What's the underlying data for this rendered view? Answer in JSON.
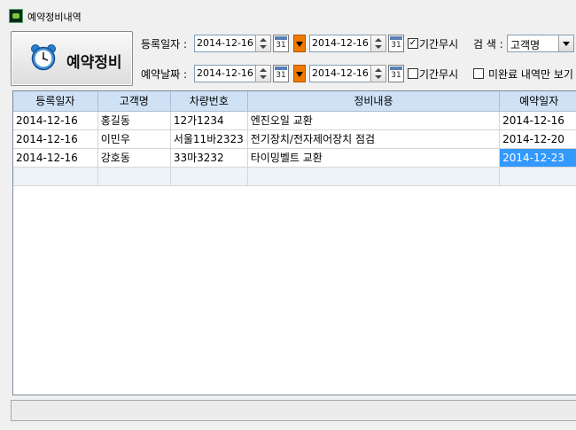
{
  "window": {
    "title": "예약정비내역"
  },
  "main_button": {
    "label": "예약정비"
  },
  "filters": {
    "reg_label": "등록일자 :",
    "reg_from": "2014-12-16",
    "reg_to": "2014-12-16",
    "reg_ignore_label": "기간무시",
    "reg_ignore_checked": true,
    "search_label": "검 색 :",
    "search_value": "고객명",
    "res_label": "예약날짜 :",
    "res_from": "2014-12-16",
    "res_to": "2014-12-16",
    "res_ignore_label": "기간무시",
    "res_ignore_checked": false,
    "incomplete_label": "미완료 내역만 보기",
    "calendar_glyph": "31"
  },
  "grid": {
    "columns": [
      "등록일자",
      "고객명",
      "차량번호",
      "정비내용",
      "예약일자"
    ],
    "rows": [
      [
        "2014-12-16",
        "홍길동",
        "12가1234",
        "엔진오일 교환",
        "2014-12-16"
      ],
      [
        "2014-12-16",
        "이민우",
        "서울11바2323",
        "전기장치/전자제어장치 점검",
        "2014-12-20"
      ],
      [
        "2014-12-16",
        "강호동",
        "33마3232",
        "타이밍벨트 교환",
        "2014-12-23"
      ]
    ]
  }
}
